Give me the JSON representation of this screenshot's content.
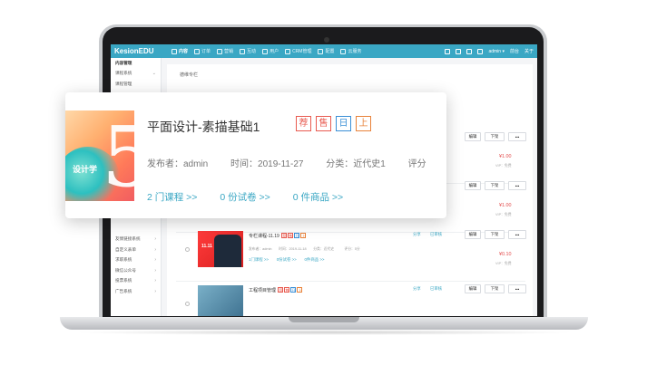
{
  "app": {
    "logo": "KesionEDU"
  },
  "topnav": [
    {
      "icon": "content-icon",
      "label": "内容",
      "active": true
    },
    {
      "icon": "order-icon",
      "label": "订单"
    },
    {
      "icon": "marketing-icon",
      "label": "营销"
    },
    {
      "icon": "interact-icon",
      "label": "互动"
    },
    {
      "icon": "user-icon",
      "label": "用户"
    },
    {
      "icon": "crm-icon",
      "label": "CRM管理"
    },
    {
      "icon": "settings-icon",
      "label": "配置"
    },
    {
      "icon": "cloud-icon",
      "label": "云服务"
    }
  ],
  "topright": {
    "user": "admin ▾",
    "link1": "前台",
    "link2": "关于"
  },
  "sidebar": {
    "head": "内容管理",
    "items": [
      "课程系统",
      "课程管理",
      "",
      "",
      "",
      "",
      "",
      "",
      "",
      "",
      "",
      "",
      "",
      "",
      "",
      "",
      "",
      "",
      "友情链接系统",
      "自定义表单",
      "求职系统",
      "微信公众号",
      "投票系统",
      "广告系统"
    ]
  },
  "main": {
    "breadcrumb": "德维专栏"
  },
  "rows": [
    {
      "title": "",
      "meta": "",
      "links": "",
      "price": "¥1.00",
      "vip": "VIP：免费",
      "share": "",
      "onshelf": "",
      "edit": "编辑",
      "down": "下架",
      "more": "•••"
    },
    {
      "title": "",
      "meta": "",
      "links": "",
      "price": "¥1.00",
      "vip": "VIP：免费",
      "share": "",
      "onshelf": "",
      "edit": "编辑",
      "down": "下架",
      "more": "•••"
    },
    {
      "title": "专栏课程-11.19",
      "meta": "发布者：admin　　时间：2019-11-18　　分类：近代史　　　评分：5分",
      "links": "1门课程 >>　　0份试卷 >>　　0件商品 >>",
      "price": "¥0.10",
      "vip": "VIP：免费",
      "share": "分享",
      "onshelf": "已审核",
      "edit": "编辑",
      "down": "下架",
      "more": "•••"
    },
    {
      "title": "工程项目管理",
      "meta": "",
      "links": "",
      "price": "",
      "vip": "",
      "share": "分享",
      "onshelf": "已审核",
      "edit": "编辑",
      "down": "下架",
      "more": "•••"
    }
  ],
  "card": {
    "title": "平面设计-素描基础1",
    "badges": [
      "荐",
      "售",
      "日",
      "上"
    ],
    "badge_colors": [
      "#e85a4f",
      "#e85a4f",
      "#3a8fd6",
      "#e8823a"
    ],
    "publisher": "发布者：admin",
    "time": "时间：2019-11-27",
    "category": "分类：近代史1",
    "rating": "评分",
    "courses": "2 门课程 >>",
    "exams": "0 份试卷 >>",
    "goods": "0 件商品 >>"
  },
  "colors": {
    "accent": "#3aa7c4",
    "price": "#e34a4a"
  }
}
